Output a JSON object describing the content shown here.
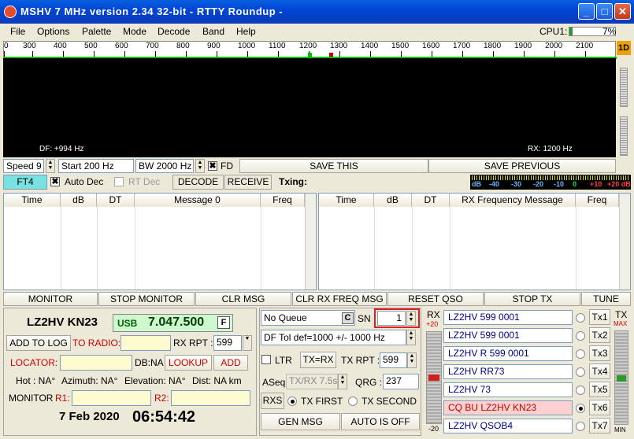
{
  "window": {
    "title": "MSHV 7 MHz version 2.34 32-bit  - RTTY Roundup -",
    "min": "_",
    "max": "□",
    "close": "✕"
  },
  "menu": [
    "File",
    "Options",
    "Palette",
    "Mode",
    "Decode",
    "Band",
    "Help"
  ],
  "cpu": {
    "label": "CPU1:",
    "value": "7%",
    "percent": 7
  },
  "scale": {
    "ticks": [
      "0",
      "300",
      "400",
      "500",
      "600",
      "700",
      "800",
      "900",
      "1000",
      "1100",
      "1200",
      "1300",
      "1400",
      "1500",
      "1600",
      "1700",
      "1800",
      "1900",
      "2000",
      "2100"
    ],
    "one_d": "1D"
  },
  "waterfall": {
    "df": "DF: +994 Hz",
    "rx": "RX: 1200 Hz"
  },
  "controls": {
    "speed": "Speed 9",
    "start": "Start 200 Hz",
    "bw": "BW 2000 Hz",
    "fd": "FD",
    "save_this": "SAVE THIS",
    "save_previous": "SAVE PREVIOUS"
  },
  "modebar": {
    "mode": "FT4",
    "auto_dec": "Auto Dec",
    "rt_dec": "RT Dec",
    "decode": "DECODE",
    "receive": "RECEIVE",
    "txing": "Txing:"
  },
  "meter": {
    "labels": [
      "dB",
      "-40",
      "-30",
      "-20",
      "-10",
      "0",
      "+10",
      "+20 dB"
    ]
  },
  "left_table": {
    "headers": [
      "Time",
      "dB",
      "DT",
      "Message 0",
      "Freq"
    ]
  },
  "right_table": {
    "headers": [
      "Time",
      "dB",
      "DT",
      "RX Frequency Message",
      "Freq"
    ]
  },
  "actions": [
    "MONITOR",
    "STOP MONITOR",
    "CLR MSG",
    "CLR RX FREQ MSG",
    "RESET QSO",
    "STOP TX",
    "TUNE"
  ],
  "station": {
    "call": "LZ2HV KN23",
    "mode": "USB",
    "freq": "7.047.500",
    "f": "F",
    "add_to_log": "ADD TO LOG",
    "to_radio": "TO RADIO:",
    "rx_rpt": "RX RPT :",
    "rx_rpt_val": "599",
    "locator": "LOCATOR:",
    "db_na": "DB:NA",
    "lookup": "LOOKUP",
    "add": "ADD",
    "hot": "Hot : NA°",
    "azimuth": "Azimuth: NA°",
    "elevation": "Elevation: NA°",
    "dist": "Dist: NA km",
    "monitor": "MONITOR",
    "r1": "R1:",
    "r2": "R2:",
    "date": "7 Feb 2020",
    "time": "06:54:42"
  },
  "middle": {
    "queue": "No Queue",
    "c": "C",
    "sn": "SN",
    "sn_val": "1",
    "df_tol": "DF Tol def=1000 +/-  1000  Hz",
    "ltr": "LTR",
    "tx_rx": "TX=RX",
    "tx_rpt": "TX RPT :",
    "tx_rpt_val": "599",
    "aseq": "ASeq",
    "txrx_val": "TX/RX 7.5s",
    "qrg": "QRG :",
    "qrg_val": "237",
    "rxs": "RXS",
    "tx_first": "TX FIRST",
    "tx_second": "TX SECOND",
    "gen_msg": "GEN MSG",
    "auto_off": "AUTO IS OFF"
  },
  "rx_scale": {
    "top": "RX",
    "p20": "+20",
    "m20": "-20"
  },
  "tx_scale": {
    "top": "TX",
    "max": "MAX",
    "min": "MIN"
  },
  "tx_msgs": [
    {
      "text": "LZ2HV 599 0001",
      "btn": "Tx1"
    },
    {
      "text": "LZ2HV 599 0001",
      "btn": "Tx2"
    },
    {
      "text": "LZ2HV R 599 0001",
      "btn": "Tx3"
    },
    {
      "text": "LZ2HV RR73",
      "btn": "Tx4"
    },
    {
      "text": "LZ2HV 73",
      "btn": "Tx5"
    },
    {
      "text": "CQ BU LZ2HV KN23",
      "btn": "Tx6"
    },
    {
      "text": "LZ2HV QSOB4",
      "btn": "Tx7"
    }
  ],
  "colors": {
    "waterfall": "#000000",
    "accent_green": "#00c000",
    "highlight": "#ffd0d0",
    "mode_bg": "#79e2e0"
  }
}
